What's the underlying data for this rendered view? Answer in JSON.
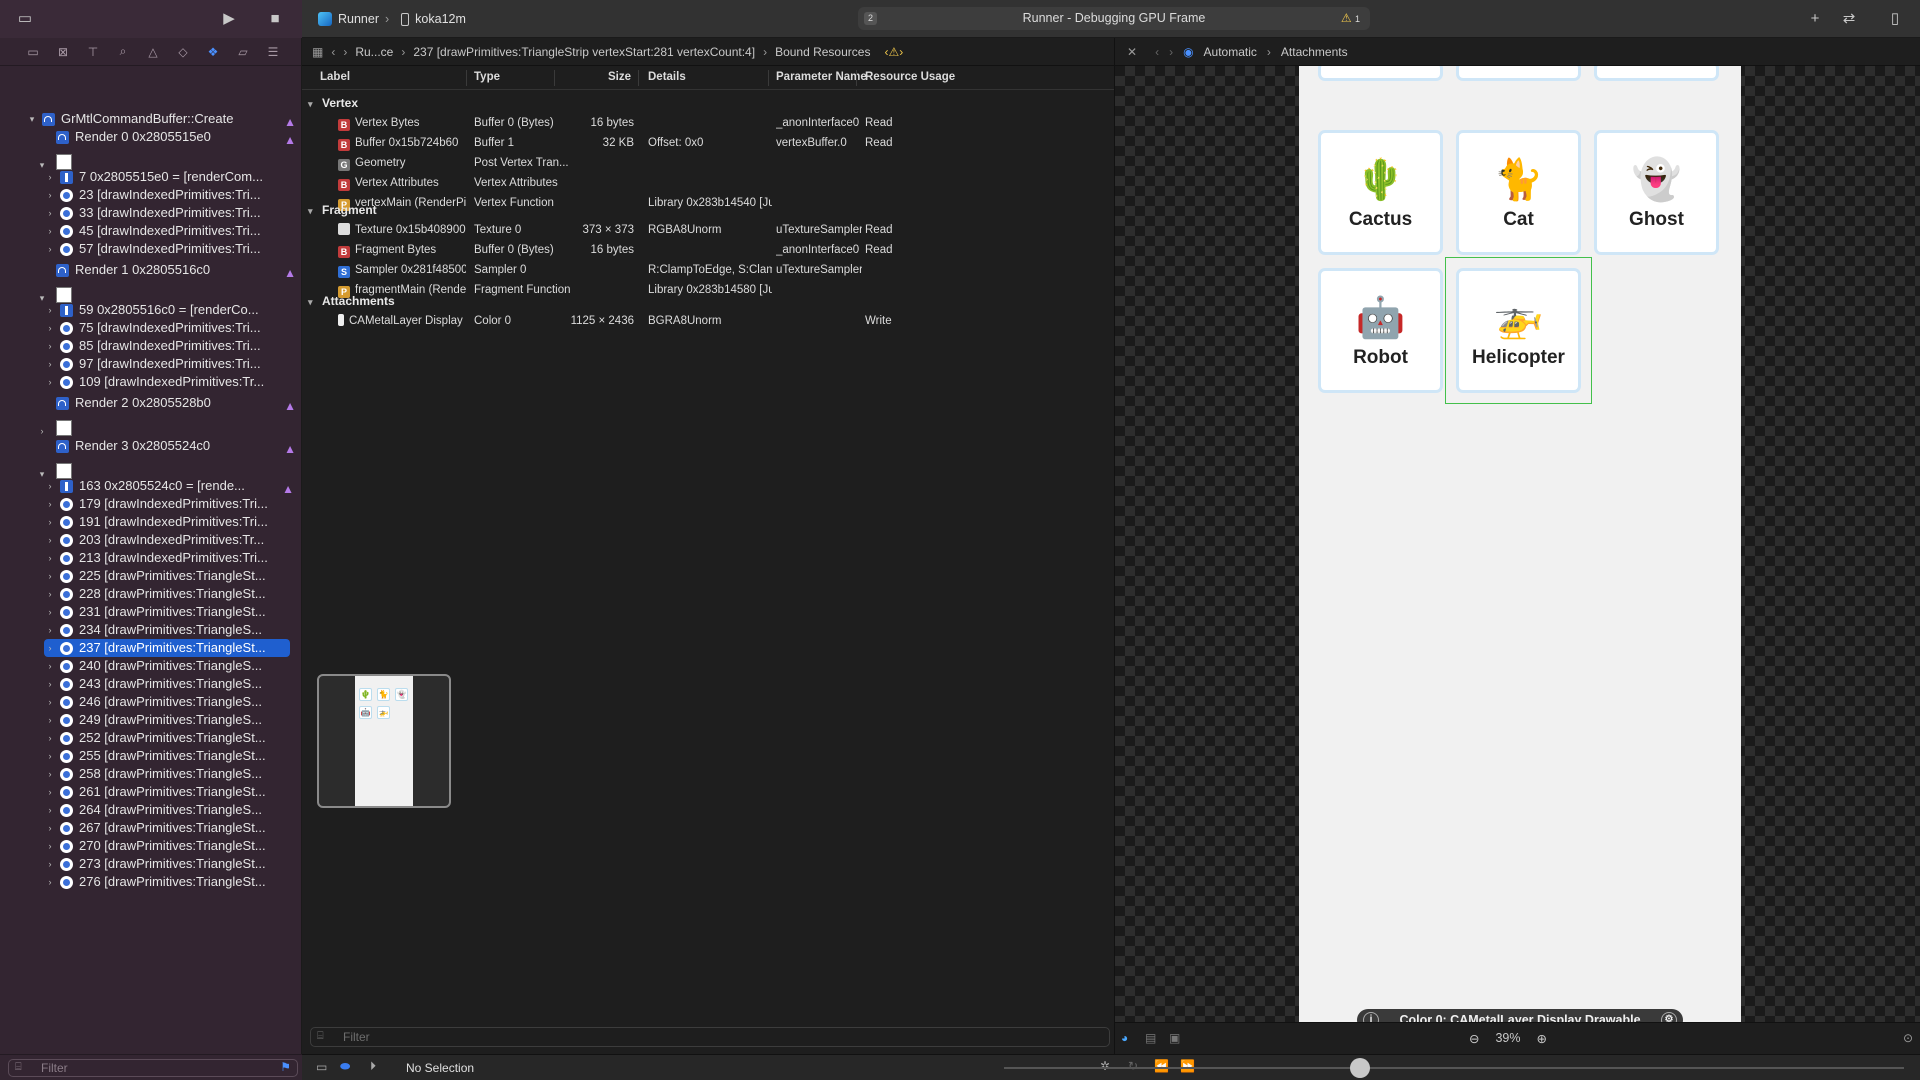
{
  "toolbar": {
    "scheme_app": "Runner",
    "scheme_device": "koka12m",
    "activity_count": "2",
    "activity_text": "Runner - Debugging GPU Frame",
    "warning_count": "1"
  },
  "navigator": {
    "root": "GrMtlCommandBuffer::Create",
    "filter_placeholder": "Filter",
    "items": [
      {
        "label": "Render 0 0x2805515e0",
        "kind": "pass"
      },
      {
        "label": "7 0x2805515e0 = [renderCom...",
        "kind": "cmd"
      },
      {
        "label": "23 [drawIndexedPrimitives:Tri...",
        "kind": "draw"
      },
      {
        "label": "33 [drawIndexedPrimitives:Tri...",
        "kind": "draw"
      },
      {
        "label": "45 [drawIndexedPrimitives:Tri...",
        "kind": "draw"
      },
      {
        "label": "57 [drawIndexedPrimitives:Tri...",
        "kind": "draw"
      },
      {
        "label": "Render 1 0x2805516c0",
        "kind": "pass"
      },
      {
        "label": "59 0x2805516c0 = [renderCo...",
        "kind": "cmd"
      },
      {
        "label": "75 [drawIndexedPrimitives:Tri...",
        "kind": "draw"
      },
      {
        "label": "85 [drawIndexedPrimitives:Tri...",
        "kind": "draw"
      },
      {
        "label": "97 [drawIndexedPrimitives:Tri...",
        "kind": "draw"
      },
      {
        "label": "109 [drawIndexedPrimitives:Tr...",
        "kind": "draw"
      },
      {
        "label": "Render 2 0x2805528b0",
        "kind": "pass"
      },
      {
        "label": "Render 3 0x2805524c0",
        "kind": "pass"
      },
      {
        "label": "163 0x2805524c0 = [rende...",
        "kind": "cmd"
      },
      {
        "label": "179 [drawIndexedPrimitives:Tri...",
        "kind": "draw"
      },
      {
        "label": "191 [drawIndexedPrimitives:Tri...",
        "kind": "draw"
      },
      {
        "label": "203 [drawIndexedPrimitives:Tr...",
        "kind": "draw"
      },
      {
        "label": "213 [drawIndexedPrimitives:Tri...",
        "kind": "draw"
      },
      {
        "label": "225 [drawPrimitives:TriangleSt...",
        "kind": "draw"
      },
      {
        "label": "228 [drawPrimitives:TriangleSt...",
        "kind": "draw"
      },
      {
        "label": "231 [drawPrimitives:TriangleSt...",
        "kind": "draw"
      },
      {
        "label": "234 [drawPrimitives:TriangleS...",
        "kind": "draw"
      },
      {
        "label": "237 [drawPrimitives:TriangleSt...",
        "kind": "draw",
        "selected": true
      },
      {
        "label": "240 [drawPrimitives:TriangleS...",
        "kind": "draw"
      },
      {
        "label": "243 [drawPrimitives:TriangleS...",
        "kind": "draw"
      },
      {
        "label": "246 [drawPrimitives:TriangleS...",
        "kind": "draw"
      },
      {
        "label": "249 [drawPrimitives:TriangleS...",
        "kind": "draw"
      },
      {
        "label": "252 [drawPrimitives:TriangleSt...",
        "kind": "draw"
      },
      {
        "label": "255 [drawPrimitives:TriangleSt...",
        "kind": "draw"
      },
      {
        "label": "258 [drawPrimitives:TriangleS...",
        "kind": "draw"
      },
      {
        "label": "261 [drawPrimitives:TriangleSt...",
        "kind": "draw"
      },
      {
        "label": "264 [drawPrimitives:TriangleS...",
        "kind": "draw"
      },
      {
        "label": "267 [drawPrimitives:TriangleSt...",
        "kind": "draw"
      },
      {
        "label": "270 [drawPrimitives:TriangleSt...",
        "kind": "draw"
      },
      {
        "label": "273 [drawPrimitives:TriangleSt...",
        "kind": "draw"
      },
      {
        "label": "276 [drawPrimitives:TriangleSt...",
        "kind": "draw"
      }
    ]
  },
  "editor": {
    "jump": {
      "seg1": "Ru...ce",
      "seg2": "237 [drawPrimitives:TriangleStrip vertexStart:281 vertexCount:4]",
      "seg3": "Bound Resources"
    },
    "columns": {
      "label": "Label",
      "type": "Type",
      "size": "Size",
      "details": "Details",
      "param": "Parameter Name",
      "usage": "Resource Usage"
    },
    "sections": {
      "vertex": "Vertex",
      "fragment": "Fragment",
      "attachments": "Attachments"
    },
    "vertex_rows": [
      {
        "badge": "B",
        "label": "Vertex Bytes",
        "type": "Buffer 0 (Bytes)",
        "size": "16 bytes",
        "details": "",
        "param": "_anonInterface0",
        "usage": "Read"
      },
      {
        "badge": "B",
        "label": "Buffer 0x15b724b60",
        "type": "Buffer 1",
        "size": "32 KB",
        "details": "Offset: 0x0",
        "param": "vertexBuffer.0",
        "usage": "Read"
      },
      {
        "badge": "G",
        "label": "Geometry",
        "type": "Post Vertex Tran...",
        "size": "",
        "details": "",
        "param": "",
        "usage": ""
      },
      {
        "badge": "B",
        "label": "Vertex Attributes",
        "type": "Vertex Attributes",
        "size": "",
        "details": "",
        "param": "",
        "usage": ""
      },
      {
        "badge": "P",
        "label": "vertexMain (RenderPipeli...",
        "type": "Vertex Function",
        "size": "",
        "details": "Library 0x283b14540 [Ju...",
        "param": "",
        "usage": ""
      }
    ],
    "fragment_rows": [
      {
        "badge": "T",
        "label": "Texture 0x15b408900",
        "type": "Texture 0",
        "size": "373 × 373",
        "details": "RGBA8Unorm",
        "param": "uTextureSampler...",
        "usage": "Read"
      },
      {
        "badge": "B",
        "label": "Fragment Bytes",
        "type": "Buffer 0 (Bytes)",
        "size": "16 bytes",
        "details": "",
        "param": "_anonInterface0",
        "usage": "Read"
      },
      {
        "badge": "S",
        "label": "Sampler 0x281f48500",
        "type": "Sampler 0",
        "size": "",
        "details": "R:ClampToEdge, S:ClampT...",
        "param": "uTextureSampler...",
        "usage": ""
      },
      {
        "badge": "P",
        "label": "fragmentMain (RenderPip...",
        "type": "Fragment Function",
        "size": "",
        "details": "Library 0x283b14580 [Ju...",
        "param": "",
        "usage": ""
      }
    ],
    "attachment_rows": [
      {
        "badge": "W",
        "label": "CAMetalLayer Display Dra...",
        "type": "Color 0",
        "size": "1125 × 2436",
        "details": "BGRA8Unorm",
        "param": "",
        "usage": "Write"
      }
    ],
    "filter_placeholder": "Filter"
  },
  "viewer": {
    "jump_mode": "Automatic",
    "jump_target": "Attachments",
    "cards": [
      {
        "emoji": "🌵",
        "label": "Cactus"
      },
      {
        "emoji": "🐈",
        "label": "Cat"
      },
      {
        "emoji": "👻",
        "label": "Ghost"
      },
      {
        "emoji": "🤖",
        "label": "Robot"
      },
      {
        "emoji": "🚁",
        "label": "Helicopter",
        "selected": true
      }
    ],
    "overlay_label": "Color 0: CAMetalLayer Display Drawable",
    "zoom": "39%"
  },
  "debugbar": {
    "selection_label": "No Selection"
  },
  "colors": {
    "accent": "#1f5fcf",
    "warning": "#f2c94c",
    "selection_outline": "#43c04b",
    "card_border": "#cfe6f7"
  }
}
